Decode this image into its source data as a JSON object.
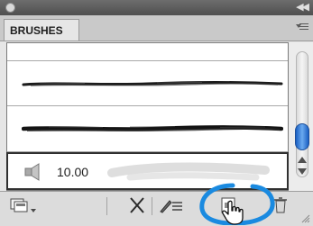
{
  "panel": {
    "tab_label": "BRUSHES"
  },
  "brush_list": {
    "strokes": [
      "charcoal-stroke-thin",
      "charcoal-stroke-thick"
    ],
    "selected_size": "10.00"
  },
  "toolbar": {
    "buttons": [
      "brush-libraries-menu",
      "remove-brush-stroke",
      "options-of-selected-object",
      "new-brush",
      "delete-brush"
    ]
  },
  "colors": {
    "highlight": "#1a8ae0",
    "scroll_thumb": "#3b82e0"
  }
}
